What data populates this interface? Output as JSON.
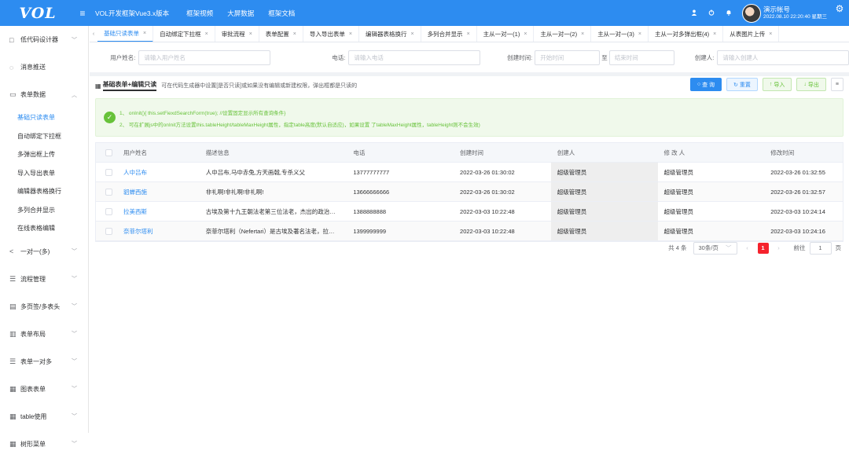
{
  "header": {
    "logo": "VOL",
    "menu_icon": "≡",
    "app_title": "VOL开发框架Vue3.x版本",
    "nav": [
      "框架视频",
      "大屏数据",
      "框架文档"
    ],
    "user_name": "演示帐号",
    "user_time": "2022.08.10 22:20:40 星期三"
  },
  "sidebar": {
    "groups_top": [
      {
        "icon": "□",
        "label": "低代码设计器"
      },
      {
        "icon": "◌",
        "label": "消息推送"
      },
      {
        "icon": "▭",
        "label": "表单数据",
        "open": true
      }
    ],
    "sub_items": [
      "基础只读表单",
      "自动绑定下拉框",
      "多弹出框上传",
      "导入导出表单",
      "编辑器表格换行",
      "多列合并显示",
      "在线表格编辑"
    ],
    "groups_bottom": [
      {
        "icon": "<",
        "label": "一对一(多)"
      },
      {
        "icon": "☰",
        "label": "流程管理"
      },
      {
        "icon": "▤",
        "label": "多页签/多表头"
      },
      {
        "icon": "▥",
        "label": "表单布局"
      },
      {
        "icon": "☰",
        "label": "表单一对多"
      },
      {
        "icon": "▦",
        "label": "图表表单"
      },
      {
        "icon": "▦",
        "label": "table使用"
      },
      {
        "icon": "▦",
        "label": "树形菜单"
      }
    ]
  },
  "tabs": [
    "基础只读表单",
    "自动绑定下拉框",
    "审批流程",
    "表单配置",
    "导入导出表单",
    "编辑器表格换行",
    "多列合并显示",
    "主从一对一(1)",
    "主从一对一(2)",
    "主从一对一(3)",
    "主从一对多弹出框(4)",
    "从表图片上传"
  ],
  "search": {
    "username_label": "用户姓名:",
    "username_placeholder": "请输入用户姓名",
    "phone_label": "电话:",
    "phone_placeholder": "请输入电话",
    "created_label": "创建时间:",
    "start_placeholder": "开始时间",
    "to": "至",
    "end_placeholder": "结束时间",
    "creator_label": "创建人:",
    "creator_placeholder": "请输入创建人"
  },
  "titlebar": {
    "title": "基础表单+编辑只读",
    "desc": "可在代码生成器中设置[是否只读]或如果没有编辑或新建权限，弹出框都是只读的",
    "query": "查 询",
    "reset": "重置",
    "import": "导入",
    "export": "导出"
  },
  "alert": {
    "line1": "1、 onInit(){ this.setFiexdSearchForm(true); //设置固定显示所有查询条件}",
    "line2": "2、 可在扩展js中的onInit方法设置this.tableHeight/tableMaxHeight属性，指定table高度(默认自适应)，如果设置 了tableMaxHeight属性，tableHeight则不会生效)"
  },
  "table": {
    "columns": [
      "用户姓名",
      "描述信息",
      "电话",
      "创建时间",
      "创建人",
      "修 改 人",
      "修改时间"
    ],
    "rows": [
      [
        "人中吕布",
        "人中吕布,马中赤兔,方天画戟,专杀义父",
        "13777777777",
        "2022-03-26 01:30:02",
        "超级管理员",
        "超级管理员",
        "2022-03-26 01:32:55"
      ],
      [
        "貂蝉西施",
        "非礼啊!非礼啊!非礼啊!",
        "13666666666",
        "2022-03-26 01:30:02",
        "超级管理员",
        "超级管理员",
        "2022-03-26 01:32:57"
      ],
      [
        "拉美西斯",
        "古埃及第十九王朝法老第三位法老，杰出的政治…",
        "1388888888",
        "2022-03-03 10:22:48",
        "超级管理员",
        "超级管理员",
        "2022-03-03 10:24:14"
      ],
      [
        "奈菲尔塔利",
        "奈菲尔塔利（Nefertari）是古埃及著名法老，拉…",
        "1399999999",
        "2022-03-03 10:22:48",
        "超级管理员",
        "超级管理员",
        "2022-03-03 10:24:16"
      ]
    ]
  },
  "pager": {
    "total": "共 4 条",
    "page_size": "30条/页",
    "current": "1",
    "goto": "前往",
    "goto_value": "1",
    "page_unit": "页"
  }
}
